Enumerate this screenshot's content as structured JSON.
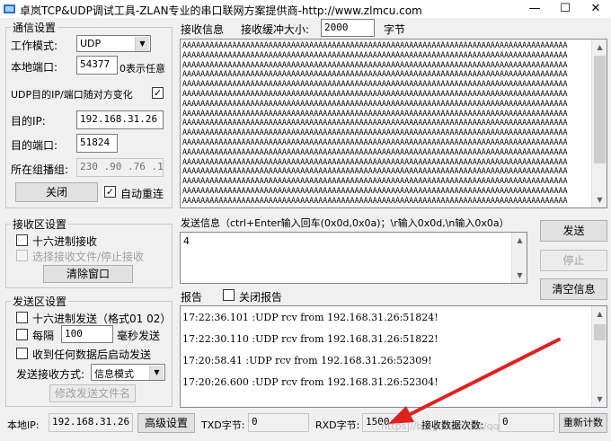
{
  "window": {
    "title": "卓岚TCP&UDP调试工具-ZLAN专业的串口联网方案提供商-http://www.zlmcu.com",
    "minimize_glyph": "—",
    "maximize_glyph": "☐",
    "close_glyph": "✕"
  },
  "comm_settings": {
    "group_label": "通信设置",
    "mode_label": "工作模式:",
    "mode_value": "UDP",
    "local_port_label": "本地端口:",
    "local_port_value": "54377",
    "local_port_hint": "0表示任意",
    "udp_follow_label": "UDP目的IP/端口随对方变化",
    "udp_follow_checked": "✓",
    "dest_ip_label": "目的IP:",
    "dest_ip_value": "192.168.31.26",
    "dest_port_label": "目的端口:",
    "dest_port_value": "51824",
    "multicast_label": "所在组播组:",
    "multicast_value": "230 .90 .76 .1",
    "close_button": "关闭",
    "auto_reconnect_label": "自动重连",
    "auto_reconnect_checked": "✓"
  },
  "receive_settings": {
    "group_label": "接收区设置",
    "hex_receive_label": "十六进制接收",
    "select_file_label": "选择接收文件/停止接收",
    "clear_window_button": "清除窗口"
  },
  "send_settings": {
    "group_label": "发送区设置",
    "hex_send_label": "十六进制发送（格式01 02）",
    "every_label": "每隔",
    "every_value": "100",
    "ms_send_label": "毫秒发送",
    "send_after_rx_label": "收到任何数据后启动发送",
    "send_mode_label": "发送接收方式:",
    "send_mode_value": "信息模式",
    "modify_send_file_button": "修改发送文件名"
  },
  "receive_panel": {
    "title": "接收信息",
    "buffer_label": "接收缓冲大小:",
    "buffer_value": "2000",
    "buffer_unit": "字节",
    "lines": [
      "AAAAAAAAAAAAAAAAAAAAAAAAAAAAAAAAAAAAAAAAAAAAAAAAAAAAAAAAAAAAAAAAAAAAAAAAAAAAAAAAAAAAA",
      "AAAAAAAAAAAAAAAAAAAAAAAAAAAAAAAAAAAAAAAAAAAAAAAAAAAAAAAAAAAAAAAAAAAAAAAAAAAAAAAAAAAAA",
      "AAAAAAAAAAAAAAAAAAAAAAAAAAAAAAAAAAAAAAAAAAAAAAAAAAAAAAAAAAAAAAAAAAAAAAAAAAAAAAAAAAAAA",
      "AAAAAAAAAAAAAAAAAAAAAAAAAAAAAAAAAAAAAAAAAAAAAAAAAAAAAAAAAAAAAAAAAAAAAAAAAAAAAAAAAAAAA",
      "AAAAAAAAAAAAAAAAAAAAAAAAAAAAAAAAAAAAAAAAAAAAAAAAAAAAAAAAAAAAAAAAAAAAAAAAAAAAAAAAAAAAA",
      "AAAAAAAAAAAAAAAAAAAAAAAAAAAAAAAAAAAAAAAAAAAAAAAAAAAAAAAAAAAAAAAAAAAAAAAAAAAAAAAAAAAAA",
      "AAAAAAAAAAAAAAAAAAAAAAAAAAAAAAAAAAAAAAAAAAAAAAAAAAAAAAAAAAAAAAAAAAAAAAAAAAAAAAAAAAAAA",
      "AAAAAAAAAAAAAAAAAAAAAAAAAAAAAAAAAAAAAAAAAAAAAAAAAAAAAAAAAAAAAAAAAAAAAAAAAAAAAAAAAAAAA",
      "AAAAAAAAAAAAAAAAAAAAAAAAAAAAAAAAAAAAAAAAAAAAAAAAAAAAAAAAAAAAAAAAAAAAAAAAAAAAAAAAAAAAA",
      "AAAAAAAAAAAAAAAAAAAAAAAAAAAAAAAAAAAAAAAAAAAAAAAAAAAAAAAAAAAAAAAAAAAAAAAAAAAAAAAAAAAAA",
      "AAAAAAAAAAAAAAAAAAAAAAAAAAAAAAAAAAAAAAAAAAAAAAAAAAAAAAAAAAAAAAAAAAAAAAAAAAAAAAAAAAAAA",
      "AAAAAAAAAAAAAAAAAAAAAAAAAAAAAAAAAAAAAAAAAAAAAAAAAAAAAAAAAAAAAAAAAAAAAAAAAAAAAAAAAAAAA",
      "AAAAAAAAAAAAAAAAAAAAAAAAAAAAAAAAAAAAAAAAAAAAAAAAAAAAAAAAAAAAAAAAAAAAAAAAAAAAAAAAAAAAA",
      "AAAAAAAAAAAAAAAAAAAAAAAAAAAAAAAAAAAAAAAAAAAAAAAAAAAAAAAAAAAAAAAAAAAAAAAAAAAAAAAAAAAAA",
      "AAAAAAAAAAAAAAAAAAAAAAAAAAAAAAAAAAAAAAAAAAAAAAAAAAAAAAAAAAAAAAAAAAAAAAAAAAAAAAAAAAAAA",
      "AAAAAAAAAAAAAAAAAAAAAAAAAAAAAAAAAAAAAAAAAAAAAAAAAAAAAAAAAAAAAAAAAAAAAAAAAAAAAAAAAAAAA",
      "AAAAAAAAAAAAAAAAAAAAAAAAAAAAAAAAAAAAAAAAAAAAAAAAAAAAAAAAAAAAAAAAAAAAAAAAAAAAAAAAAAAAA"
    ]
  },
  "send_panel": {
    "title": "发送信息（ctrl+Enter输入回车(0x0d,0x0a)；\\r输入0x0d,\\n输入0x0a）",
    "value": "4",
    "send_button": "发送",
    "stop_button": "停止",
    "clear_info_button": "清空信息"
  },
  "report_panel": {
    "title": "报告",
    "close_report_label": "关闭报告",
    "lines": [
      "17:22:36.101 :UDP rcv from 192.168.31.26:51824!",
      "17:22:30.110 :UDP rcv from 192.168.31.26:51822!",
      "17:20:58.41 :UDP rcv from 192.168.31.26:52309!",
      "17:20:26.600 :UDP rcv from 192.168.31.26:52304!"
    ]
  },
  "status_bar": {
    "local_ip_label": "本地IP:",
    "local_ip_value": "192.168.31.26",
    "advanced_button": "高级设置",
    "txd_label": "TXD字节:",
    "txd_value": "0",
    "rxd_label": "RXD字节:",
    "rxd_value": "1500",
    "rx_count_label": "接收数据次数:",
    "rx_count_value": "0",
    "recount_button": "重新计数",
    "watermark": "https://blog.csdn.net/qq_41..."
  },
  "colors": {
    "annotation_arrow": "#e02020"
  }
}
